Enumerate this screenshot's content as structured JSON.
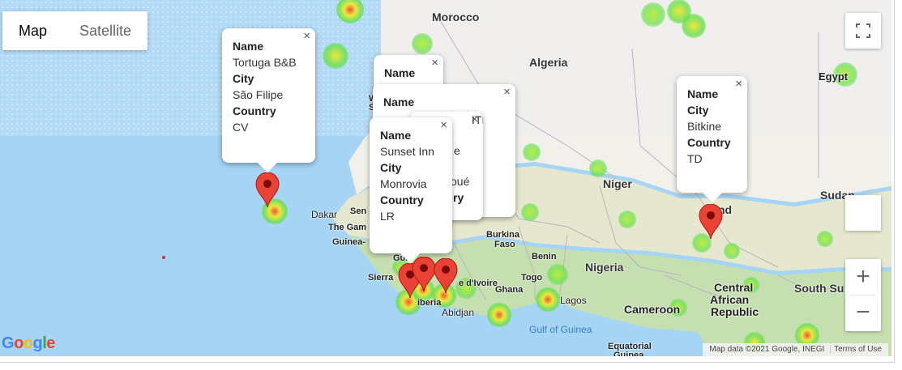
{
  "map_type": {
    "options": [
      "Map",
      "Satellite"
    ],
    "selected": "Map"
  },
  "colors": {
    "ocean": "#a6d4f5",
    "desert": "#f2f0ea",
    "savanna": "#e6e7cf",
    "forest": "#c6dfb1",
    "marker": "#ea4335",
    "heat_green": "#66e04a",
    "heat_yellow": "#eae83b",
    "heat_red": "#f05538"
  },
  "map_labels": {
    "morocco": "Morocco",
    "algeria": "Algeria",
    "egypt": "Egypt",
    "niger": "Niger",
    "chad_partial": "nd",
    "sudan_partial": "Sudan",
    "dakar": "Dakar",
    "senegal_partial": "Sen",
    "gambia_partial": "The Gam",
    "guinea_partial": "Guinea-",
    "burkina": "Burkina",
    "faso": "Faso",
    "benin": "Benin",
    "togo": "Togo",
    "ghana": "Ghana",
    "nigeria": "Nigeria",
    "cote_partial": "e d'Ivoire",
    "liberia_partial": "iberia",
    "sierra_partial": "Sierra",
    "gui_partial": "Gui",
    "abidjan": "Abidjan",
    "lagos": "Lagos",
    "cameroon": "Cameroon",
    "central": "Central",
    "african": "African",
    "republic": "Republic",
    "south_sudan_partial": "South Su",
    "gulf_of_guinea": "Gulf of Guinea",
    "equatorial": "Equatorial",
    "guinea_bottom": "Guinea",
    "w_partial": "W",
    "s_partial": "S"
  },
  "info_windows": [
    {
      "fields": [
        {
          "label": "Name",
          "value": "Tortuga B&B"
        },
        {
          "label": "City",
          "value": "São Filipe"
        },
        {
          "label": "Country",
          "value": "CV"
        }
      ]
    },
    {
      "fields": [
        {
          "label": "Name",
          "value": "Bitkine"
        },
        {
          "label": "City",
          "value": ""
        },
        {
          "label": "Country",
          "value": "TD"
        }
      ],
      "raw": [
        "Name",
        "City",
        "Bitkine",
        "Country",
        "TD"
      ]
    },
    {
      "fields": [
        {
          "label": "Name",
          "value": "Sunset Inn"
        },
        {
          "label": "City",
          "value": "Monrovia"
        },
        {
          "label": "Country",
          "value": "LR"
        }
      ]
    },
    {
      "partial_text": [
        "Name",
        "Ci"
      ]
    },
    {
      "partial_text": [
        "Name"
      ]
    },
    {
      "partial_text": [
        "ITE",
        "e",
        "oué",
        "ry"
      ]
    }
  ],
  "close_symbol": "×",
  "attribution": {
    "data": "Map data ©2021 Google, INEGI",
    "terms": "Terms of Use"
  },
  "logo": {
    "letters": [
      "G",
      "o",
      "o",
      "g",
      "l",
      "e"
    ],
    "colors": [
      "#4285f4",
      "#ea4335",
      "#fbbc05",
      "#4285f4",
      "#34a853",
      "#ea4335"
    ]
  },
  "controls": {
    "fullscreen_icon": "fullscreen-icon",
    "zoom_in": "+",
    "zoom_out": "−",
    "pegman": "pegman-icon"
  }
}
